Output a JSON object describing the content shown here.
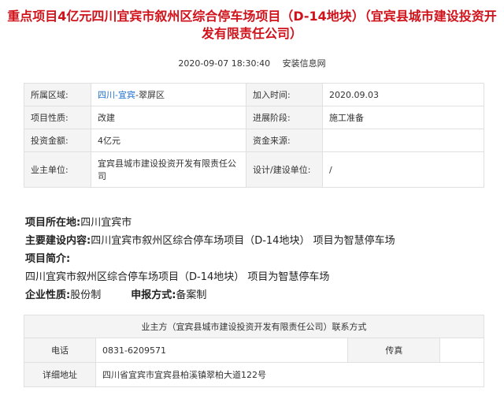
{
  "title": "重点项目4亿元四川宜宾市叙州区综合停车场项目（D-14地块）（宜宾县城市建设投资开发有限责任公司）",
  "meta": {
    "datetime": "2020-09-07  18:30:40",
    "source": "安装信息网"
  },
  "details": {
    "region_label": "所属区域:",
    "region_province": "四川",
    "region_city": "宜宾",
    "region_district": "翠屏区",
    "join_time_label": "加入时间:",
    "join_time": "2020.09.03",
    "nature_label": "项目性质:",
    "nature": "改建",
    "stage_label": "进展阶段:",
    "stage": "施工准备",
    "investment_label": "投资金额:",
    "investment": "4亿元",
    "funding_label": "资金来源:",
    "funding": "",
    "owner_label": "业主单位:",
    "owner": "宜宾县城市建设投资开发有限责任公司",
    "design_label": "设计/建设单位:",
    "design": "/"
  },
  "info": {
    "location_label": "项目所在地:",
    "location": "四川宜宾市",
    "content_label": "主要建设内容:",
    "content": "四川宜宾市叙州区综合停车场项目（D-14地块） 项目为智慧停车场",
    "intro_label": "项目简介:",
    "intro": "四川宜宾市叙州区综合停车场项目（D-14地块） 项目为智慧停车场",
    "company_type_label": "企业性质:",
    "company_type": "股份制",
    "report_label": "申报方式:",
    "report": "备案制"
  },
  "contact": {
    "header": "业主方（宜宾县城市建设投资开发有限责任公司）联系方式",
    "phone_label": "电话",
    "phone": "0831-6209571",
    "fax_label": "传真",
    "fax": "",
    "address_label": "详细地址",
    "address": "四川省宜宾市宜宾县柏溪镇翠柏大道122号"
  }
}
